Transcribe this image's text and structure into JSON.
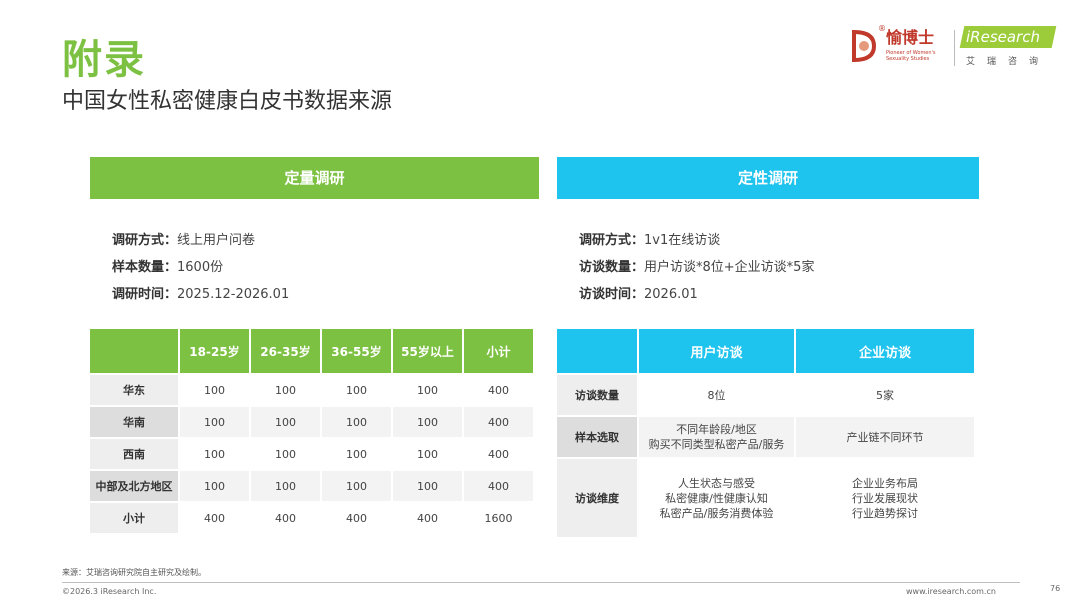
{
  "header": {
    "title": "附录",
    "subtitle": "中国女性私密健康白皮书数据来源"
  },
  "logos": {
    "yu": {
      "name": "愉博士",
      "reg": "®",
      "tagline": "Pioneer of Women's Sexuality Studies"
    },
    "iresearch": {
      "word": "iResearch",
      "cn": "艾瑞咨询"
    }
  },
  "quant": {
    "band": "定量调研",
    "info": [
      {
        "k": "调研方式：",
        "v": "线上用户问卷"
      },
      {
        "k": "样本数量：",
        "v": "1600份"
      },
      {
        "k": "调研时间：",
        "v": "2025.12-2026.01"
      }
    ],
    "table": {
      "headers": [
        "18-25岁",
        "26-35岁",
        "36-55岁",
        "55岁以上",
        "小计"
      ],
      "rows": [
        {
          "label": "华东",
          "cells": [
            "100",
            "100",
            "100",
            "100",
            "400"
          ]
        },
        {
          "label": "华南",
          "cells": [
            "100",
            "100",
            "100",
            "100",
            "400"
          ]
        },
        {
          "label": "西南",
          "cells": [
            "100",
            "100",
            "100",
            "100",
            "400"
          ]
        },
        {
          "label": "中部及北方地区",
          "cells": [
            "100",
            "100",
            "100",
            "100",
            "400"
          ]
        },
        {
          "label": "小计",
          "cells": [
            "400",
            "400",
            "400",
            "400",
            "1600"
          ]
        }
      ]
    }
  },
  "qual": {
    "band": "定性调研",
    "info": [
      {
        "k": "调研方式：",
        "v": "1v1在线访谈"
      },
      {
        "k": "访谈数量：",
        "v": "用户访谈*8位+企业访谈*5家"
      },
      {
        "k": "访谈时间：",
        "v": "2026.01"
      }
    ],
    "table": {
      "headers": [
        "用户访谈",
        "企业访谈"
      ],
      "rows": [
        {
          "label": "访谈数量",
          "cells": [
            [
              "8位"
            ],
            [
              "5家"
            ]
          ]
        },
        {
          "label": "样本选取",
          "cells": [
            [
              "不同年龄段/地区",
              "购买不同类型私密产品/服务"
            ],
            [
              "产业链不同环节"
            ]
          ]
        },
        {
          "label": "访谈维度",
          "cells": [
            [
              "人生状态与感受",
              "私密健康/性健康认知",
              "私密产品/服务消费体验"
            ],
            [
              "企业业务布局",
              "行业发展现状",
              "行业趋势探讨"
            ]
          ]
        }
      ]
    }
  },
  "footer": {
    "source": "来源：艾瑞咨询研究院自主研究及绘制。",
    "copyright": "©2026.3 iResearch Inc.",
    "site": "www.iresearch.com.cn",
    "page": "76"
  }
}
